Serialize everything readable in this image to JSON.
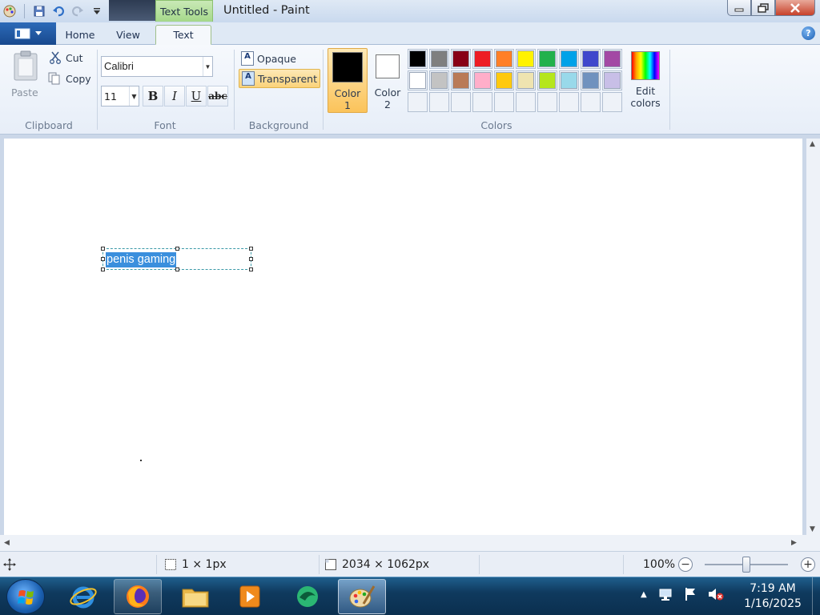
{
  "window": {
    "title": "Untitled - Paint",
    "context_tab": "Text Tools"
  },
  "tabs": {
    "home": "Home",
    "view": "View",
    "text": "Text"
  },
  "help_glyph": "?",
  "clipboard": {
    "paste": "Paste",
    "cut": "Cut",
    "copy": "Copy",
    "group_label": "Clipboard"
  },
  "font": {
    "family": "Calibri",
    "size": "11",
    "bold": "B",
    "italic": "I",
    "underline": "U",
    "strike": "abc",
    "group_label": "Font"
  },
  "background": {
    "opaque": "Opaque",
    "transparent": "Transparent",
    "selected": "Transparent",
    "group_label": "Background"
  },
  "colors": {
    "color1_label_a": "Color",
    "color1_label_b": "1",
    "color2_label_a": "Color",
    "color2_label_b": "2",
    "color1": "#000000",
    "color2": "#ffffff",
    "edit_a": "Edit",
    "edit_b": "colors",
    "group_label": "Colors",
    "palette_row1": [
      "#000000",
      "#7f7f7f",
      "#880015",
      "#ed1c24",
      "#ff7f27",
      "#fff200",
      "#22b14c",
      "#00a2e8",
      "#3f48cc",
      "#a349a4"
    ],
    "palette_row2": [
      "#ffffff",
      "#c3c3c3",
      "#b97a57",
      "#ffaec9",
      "#ffc90e",
      "#efe4b0",
      "#b5e61d",
      "#99d9ea",
      "#7092be",
      "#c8bfe7"
    ]
  },
  "canvas": {
    "text": "penis gaming"
  },
  "status": {
    "selection_size": "1 × 1px",
    "canvas_size": "2034 × 1062px",
    "zoom": "100%"
  },
  "taskbar": {
    "time": "7:19 AM",
    "date": "1/16/2025"
  }
}
